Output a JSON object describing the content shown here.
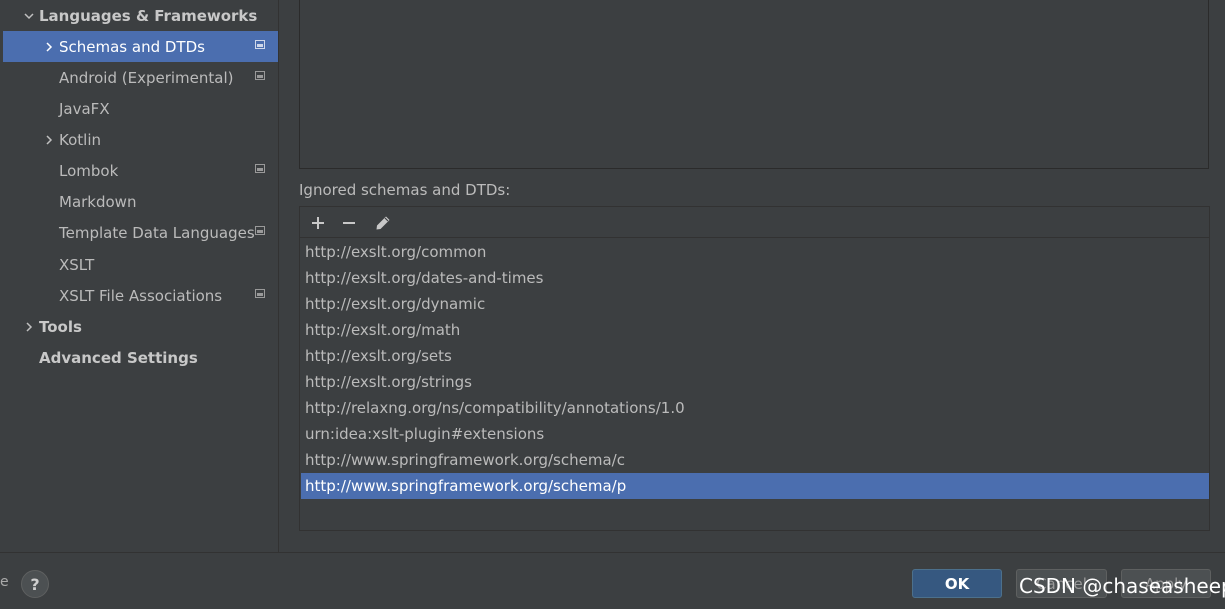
{
  "sidebar": {
    "items": [
      {
        "label": "Languages & Frameworks",
        "expand": "expanded",
        "bold": true,
        "project_icon": false,
        "selected": false
      },
      {
        "label": "Schemas and DTDs",
        "expand": "collapsed",
        "bold": false,
        "project_icon": true,
        "selected": true
      },
      {
        "label": "Android (Experimental)",
        "expand": "none",
        "bold": false,
        "project_icon": true,
        "selected": false
      },
      {
        "label": "JavaFX",
        "expand": "none",
        "bold": false,
        "project_icon": false,
        "selected": false
      },
      {
        "label": "Kotlin",
        "expand": "collapsed",
        "bold": false,
        "project_icon": false,
        "selected": false
      },
      {
        "label": "Lombok",
        "expand": "none",
        "bold": false,
        "project_icon": true,
        "selected": false
      },
      {
        "label": "Markdown",
        "expand": "none",
        "bold": false,
        "project_icon": false,
        "selected": false
      },
      {
        "label": "Template Data Languages",
        "expand": "none",
        "bold": false,
        "project_icon": true,
        "selected": false
      },
      {
        "label": "XSLT",
        "expand": "none",
        "bold": false,
        "project_icon": false,
        "selected": false
      },
      {
        "label": "XSLT File Associations",
        "expand": "none",
        "bold": false,
        "project_icon": true,
        "selected": false
      },
      {
        "label": "Tools",
        "expand": "collapsed",
        "bold": true,
        "project_icon": false,
        "selected": false
      },
      {
        "label": "Advanced Settings",
        "expand": "none",
        "bold": true,
        "project_icon": false,
        "selected": false
      }
    ]
  },
  "ignored": {
    "title": "Ignored schemas and DTDs:",
    "toolbar": {
      "add_icon": "plus-icon",
      "remove_icon": "minus-icon",
      "edit_icon": "pencil-icon"
    },
    "items": [
      "http://exslt.org/common",
      "http://exslt.org/dates-and-times",
      "http://exslt.org/dynamic",
      "http://exslt.org/math",
      "http://exslt.org/sets",
      "http://exslt.org/strings",
      "http://relaxng.org/ns/compatibility/annotations/1.0",
      "urn:idea:xslt-plugin#extensions",
      "http://www.springframework.org/schema/c",
      "http://www.springframework.org/schema/p"
    ],
    "selected_index": 9
  },
  "footer": {
    "help_label": "?",
    "ok_label": "OK",
    "cancel_label": "Cancel",
    "apply_label": "Apply"
  },
  "watermark": "CSDN @chaseasheep",
  "edge_glyph": "e",
  "colors": {
    "background": "#3c3f41",
    "selection": "#4b6eaf",
    "ok_button": "#365880",
    "text": "#bbbbbb"
  }
}
